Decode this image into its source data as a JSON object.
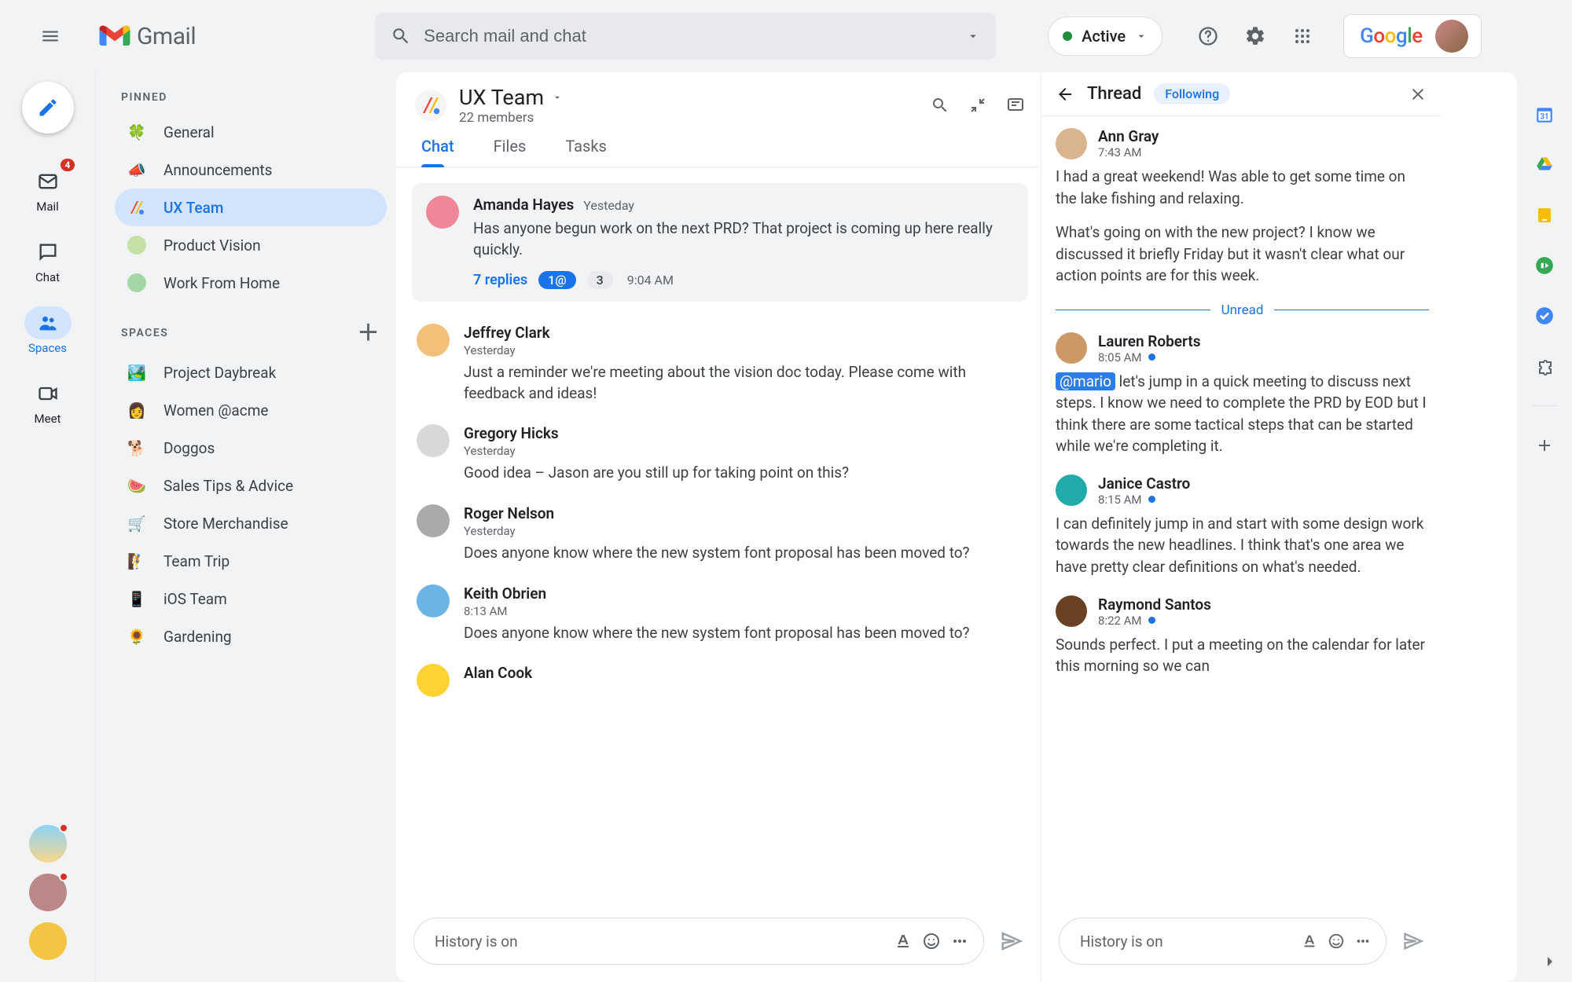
{
  "header": {
    "app_name": "Gmail",
    "search_placeholder": "Search mail and chat",
    "status_label": "Active"
  },
  "rail": {
    "mail_label": "Mail",
    "mail_badge": "4",
    "chat_label": "Chat",
    "spaces_label": "Spaces",
    "meet_label": "Meet"
  },
  "sidebar": {
    "pinned_header": "PINNED",
    "spaces_header": "SPACES",
    "pinned": [
      {
        "icon": "🍀",
        "label": "General"
      },
      {
        "icon": "📣",
        "label": "Announcements"
      },
      {
        "icon": "",
        "label": "UX Team",
        "active": true,
        "custom": "ux"
      },
      {
        "icon": "",
        "label": "Product Vision",
        "custom": "pv"
      },
      {
        "icon": "",
        "label": "Work From Home",
        "custom": "wfh"
      }
    ],
    "spaces": [
      {
        "icon": "🏞️",
        "label": "Project Daybreak"
      },
      {
        "icon": "👩",
        "label": "Women @acme"
      },
      {
        "icon": "🐕",
        "label": "Doggos"
      },
      {
        "icon": "🍉",
        "label": "Sales Tips & Advice"
      },
      {
        "icon": "🛒",
        "label": "Store Merchandise"
      },
      {
        "icon": "🧗",
        "label": "Team Trip"
      },
      {
        "icon": "📱",
        "label": "iOS Team"
      },
      {
        "icon": "🌻",
        "label": "Gardening"
      }
    ]
  },
  "space": {
    "name": "UX Team",
    "members": "22 members",
    "tabs": {
      "chat": "Chat",
      "files": "Files",
      "tasks": "Tasks"
    }
  },
  "messages": {
    "pinned": {
      "name": "Amanda Hayes",
      "time": "Yesteday",
      "text": "Has anyone begun work on the next PRD? That project is coming up here really quickly.",
      "replies_label": "7 replies",
      "pill_at": "1@",
      "pill_count": "3",
      "reply_time": "9:04 AM"
    },
    "list": [
      {
        "name": "Jeffrey Clark",
        "time": "Yesterday",
        "text": "Just a reminder we're meeting about the vision doc today. Please come with feedback and ideas!",
        "av": "av2"
      },
      {
        "name": "Gregory Hicks",
        "time": "Yesterday",
        "text": "Good idea – Jason are you still up for taking point on this?",
        "av": "av3"
      },
      {
        "name": "Roger Nelson",
        "time": "Yesterday",
        "text": "Does anyone know where the new system font proposal has been moved to?",
        "av": "av4"
      },
      {
        "name": "Keith Obrien",
        "time": "8:13 AM",
        "text": "Does anyone know where the new system font proposal has been moved to?",
        "av": "av5"
      },
      {
        "name": "Alan Cook",
        "time": "",
        "text": "",
        "av": "av6"
      }
    ]
  },
  "composer": {
    "placeholder": "History is on"
  },
  "thread": {
    "title": "Thread",
    "following": "Following",
    "unread": "Unread",
    "msgs": [
      {
        "name": "Ann Gray",
        "time": "7:43 AM",
        "dot": false,
        "av": "tav1",
        "text": "I had a great weekend! Was able to get some time on the lake fishing and relaxing.",
        "text2": "What's going on with the new project? I know we discussed it briefly Friday but it wasn't clear what our action points are for this week."
      },
      {
        "name": "Lauren Roberts",
        "time": "8:05 AM",
        "dot": true,
        "av": "tav2",
        "mention": "@mario",
        "text": "let's jump in a quick meeting to discuss next steps. I know we need to complete the PRD by EOD but I think there are some tactical steps that can be started while we're completing it."
      },
      {
        "name": "Janice Castro",
        "time": "8:15 AM",
        "dot": true,
        "av": "tav3",
        "text": "I can definitely jump in and start with some design work towards the new headlines. I think that's one area we have pretty clear definitions on what's needed."
      },
      {
        "name": "Raymond Santos",
        "time": "8:22 AM",
        "dot": true,
        "av": "tav4",
        "text": "Sounds perfect. I put a meeting on the calendar for later this morning so we can"
      }
    ]
  },
  "sidepanel": {}
}
